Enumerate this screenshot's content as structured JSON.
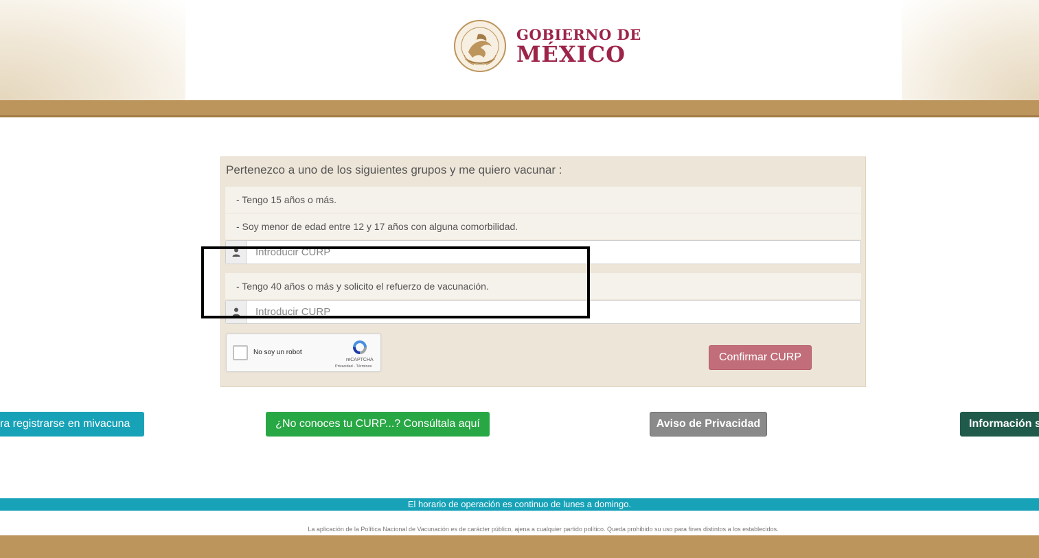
{
  "header": {
    "logo_line1": "GOBIERNO DE",
    "logo_line2": "MÉXICO",
    "seal_icon": "mexico-coat-of-arms-seal",
    "seal_text": "ESTADOS UNIDOS MEXICANOS"
  },
  "form": {
    "title": "Pertenezco a uno de los siguientes grupos y me quiero vacunar :",
    "group_15": "- Tengo 15 años o más.",
    "group_minor": "- Soy menor de edad entre 12 y 17 años con alguna comorbilidad.",
    "curp_placeholder_1": "Introducir CURP",
    "group_booster": "- Tengo 40 años o más y solicito el refuerzo de vacunación.",
    "curp_placeholder_2": "Introducir CURP",
    "curp_icon": "user-icon",
    "captcha": {
      "label": "No soy un robot",
      "brand": "reCAPTCHA",
      "links": "Privacidad - Términos"
    },
    "confirm_label": "Confirmar CURP"
  },
  "actions": {
    "register_label": "ra registrarse en mivacuna",
    "curp_lookup_label": "¿No conoces tu CURP...? Consúltala aquí",
    "privacy_label": "Aviso de Privacidad",
    "info_label": "Información s"
  },
  "footer": {
    "hours": "El horario de operación es continuo de lunes a domingo.",
    "disclaimer": "La aplicación de la Política Nacional de Vacunación es de carácter público, ajena a cualquier partido político. Queda prohibido su uso para fines distintos a los establecidos."
  },
  "colors": {
    "brand": "#9d2449",
    "gold": "#bc955c",
    "panel": "#ede5d8",
    "confirm": "#c26e7a",
    "teal": "#17a2b8",
    "green": "#28a745",
    "gray": "#8a8a8a",
    "dark_green": "#1f5a4a"
  }
}
